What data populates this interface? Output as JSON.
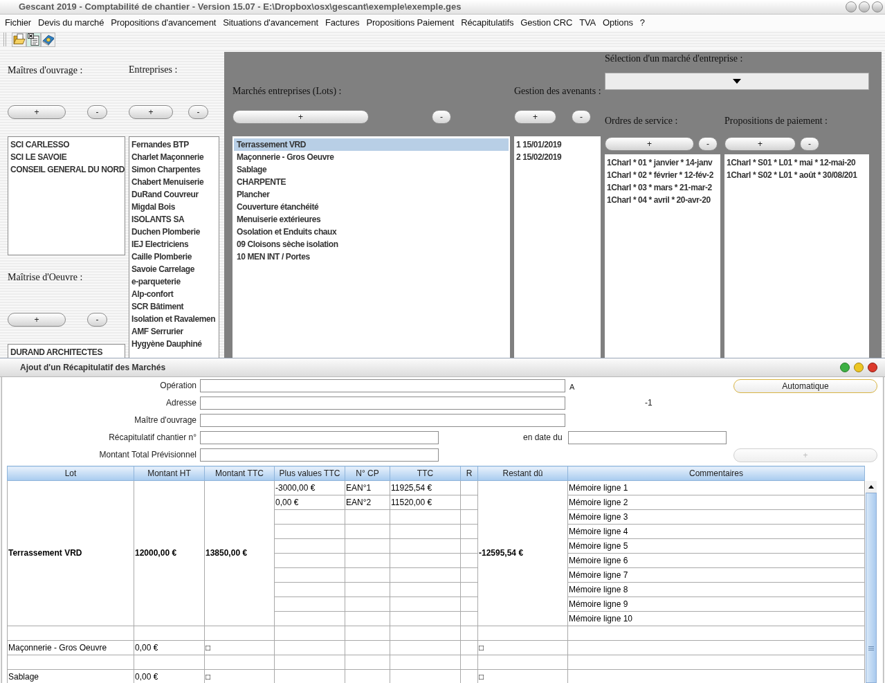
{
  "window": {
    "title": "Gescant 2019 - Comptabilité de chantier - Version 15.07 - E:\\Dropbox\\osx\\gescant\\exemple\\exemple.ges"
  },
  "menu": [
    "Fichier",
    "Devis du marché",
    "Propositions d'avancement",
    "Situations d'avancement",
    "Factures",
    "Propositions Paiement",
    "Récapitulatifs",
    "Gestion CRC",
    "TVA",
    "Options",
    "?"
  ],
  "owners": {
    "label": "Maîtres d'ouvrage :",
    "add_button": "+",
    "remove_button": "-",
    "items": [
      "SCI CARLESSO",
      "SCI LE SAVOIE",
      "CONSEIL GENERAL DU NORD"
    ]
  },
  "project_managers": {
    "label": "Maîtrise d'Oeuvre :",
    "add_button": "+",
    "remove_button": "-",
    "items": [
      "DURAND ARCHITECTES"
    ]
  },
  "companies": {
    "label": "Entreprises :",
    "add_button": "+",
    "remove_button": "-",
    "items": [
      "Fernandes BTP",
      "Charlet Maçonnerie",
      "Simon Charpentes",
      "Chabert Menuiserie",
      "DuRand Couvreur",
      "Migdal Bois",
      "ISOLANTS SA",
      "Duchen Plomberie",
      "IEJ Electriciens",
      "Caille Plomberie",
      "Savoie Carrelage",
      "e-parqueterie",
      "Alp-confort",
      "SCR Bâtiment",
      "Isolation et Ravalemen",
      "AMF Serrurier",
      "Hygyène Dauphiné"
    ]
  },
  "lots": {
    "label": "Marchés entreprises (Lots) :",
    "add_button": "+",
    "remove_button": "-",
    "items": [
      {
        "text": "Terrassement VRD",
        "selected": true
      },
      {
        "text": "Maçonnerie - Gros Oeuvre",
        "selected": false
      },
      {
        "text": "Sablage",
        "selected": false
      },
      {
        "text": "CHARPENTE",
        "selected": false
      },
      {
        "text": "Plancher",
        "selected": false
      },
      {
        "text": "Couverture étanchéité",
        "selected": false
      },
      {
        "text": "Menuiserie extérieures",
        "selected": false
      },
      {
        "text": "Osolation et Enduits chaux",
        "selected": false
      },
      {
        "text": "09 Cloisons sèche isolation",
        "selected": false
      },
      {
        "text": "10 MEN INT / Portes",
        "selected": false
      }
    ]
  },
  "amendments": {
    "label": "Gestion des avenants :",
    "add_button": "+",
    "remove_button": "-",
    "items": [
      "1 15/01/2019",
      "2 15/02/2019"
    ]
  },
  "market_selection": {
    "label": "Sélection d'un marché d'entreprise :"
  },
  "service_orders": {
    "label": "Ordres de service :",
    "add_button": "+",
    "remove_button": "-",
    "items": [
      "1Charl * 01 * janvier * 14-janv",
      "1Charl * 02 * février * 12-fév-2",
      "1Charl * 03 * mars * 21-mar-2",
      "1Charl * 04 * avril * 20-avr-20"
    ]
  },
  "payment_proposals": {
    "label": "Propositions de paiement :",
    "add_button": "+",
    "remove_button": "-",
    "items": [
      "1Charl * S01 * L01 * mai * 12-mai-20",
      "1Charl * S02 * L01 * août * 30/08/201"
    ]
  },
  "dialog": {
    "title": "Ajout d'un Récapitulatif des Marchés",
    "operation": {
      "label": "Opération"
    },
    "operation_suffix": "A",
    "address": {
      "label": "Adresse"
    },
    "address_note": "-1",
    "owner": {
      "label": "Maître d'ouvrage"
    },
    "recap_number": {
      "label": "Récapitulatif chantier n°"
    },
    "date": {
      "label": "en date du"
    },
    "total": {
      "label": "Montant Total Prévisionnel"
    },
    "auto_button": {
      "label": "Automatique"
    },
    "add_button": {
      "label": "+",
      "disabled": true
    },
    "table": {
      "columns": [
        "Lot",
        "Montant HT",
        "Montant TTC",
        "Plus values TTC",
        "N° CP",
        "TTC",
        "R",
        "Restant dû",
        "Commentaires"
      ],
      "groups": [
        {
          "lot": "Terrassement VRD",
          "montant_ht": "12000,00 €",
          "montant_ttc": "13850,00 €",
          "restant_du": "-12595,54 €",
          "emphasized": true,
          "lines": [
            {
              "plus_values_ttc": "-3000,00 €",
              "n_cp": "EAN°1",
              "ttc": "11925,54 €",
              "commentaire": "Mémoire ligne 1"
            },
            {
              "plus_values_ttc": "0,00 €",
              "n_cp": "EAN°2",
              "ttc": "11520,00 €",
              "commentaire": "Mémoire ligne 2"
            },
            {
              "commentaire": "Mémoire ligne 3"
            },
            {
              "commentaire": "Mémoire ligne 4"
            },
            {
              "commentaire": "Mémoire ligne 5"
            },
            {
              "commentaire": "Mémoire ligne 6"
            },
            {
              "commentaire": "Mémoire ligne 7"
            },
            {
              "commentaire": "Mémoire ligne 8"
            },
            {
              "commentaire": "Mémoire ligne 9"
            },
            {
              "commentaire": "Mémoire ligne 10"
            }
          ]
        },
        {
          "lot": "Maçonnerie - Gros Oeuvre",
          "montant_ht": "0,00 €",
          "montant_ttc": "□",
          "restant_du": "□",
          "emphasized": false
        },
        {
          "lot": "Sablage",
          "montant_ht": "0,00 €",
          "montant_ttc": "□",
          "restant_du": "□",
          "emphasized": false
        }
      ]
    }
  }
}
